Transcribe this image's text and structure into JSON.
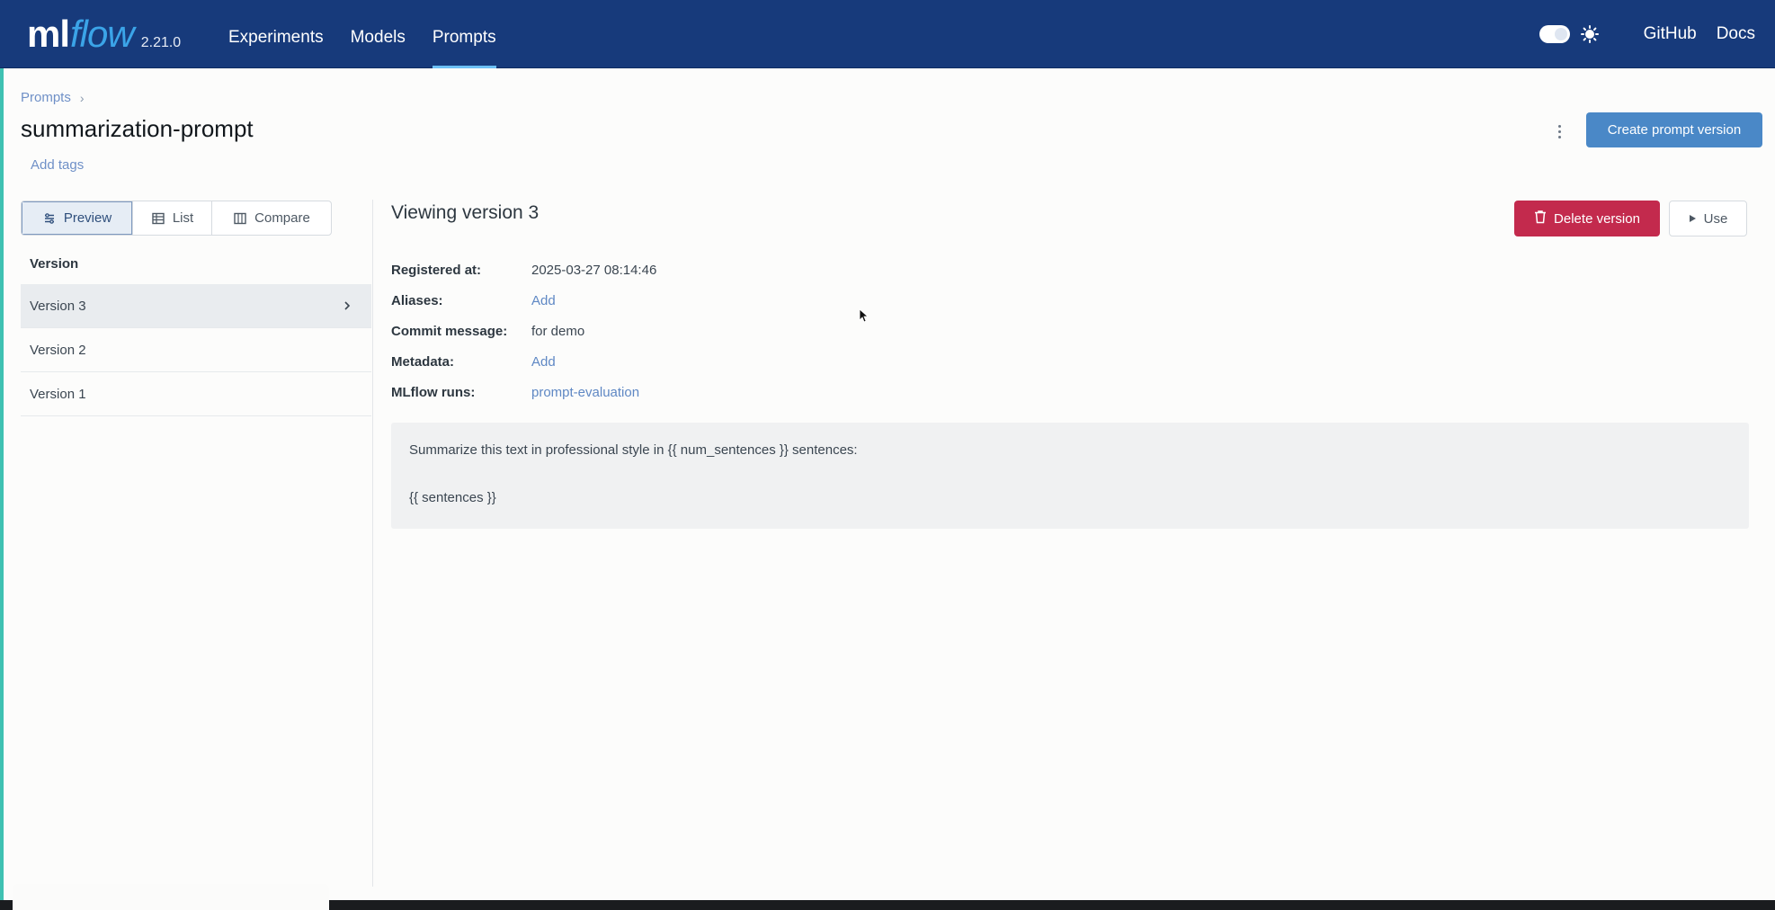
{
  "nav": {
    "logo_ml": "ml",
    "logo_flow": "flow",
    "version": "2.21.0",
    "links": [
      "Experiments",
      "Models",
      "Prompts"
    ],
    "active_link": "Prompts",
    "github": "GitHub",
    "docs": "Docs",
    "icons": [
      "theme-toggle-icon",
      "sun-icon"
    ]
  },
  "header": {
    "breadcrumb": "Prompts",
    "breadcrumb_separator": "›",
    "title": "summarization-prompt",
    "add_tags": "Add tags",
    "create_button": "Create prompt version",
    "more_icon": "kebab-menu-icon"
  },
  "view_modes": {
    "preview": "Preview",
    "list": "List",
    "compare": "Compare",
    "active": "Preview"
  },
  "versions": {
    "header": "Version",
    "items": [
      "Version 3",
      "Version 2",
      "Version 1"
    ],
    "selected": "Version 3"
  },
  "detail": {
    "title": "Viewing version 3",
    "delete_button": "Delete version",
    "use_button": "Use",
    "fields": {
      "registered_label": "Registered at:",
      "registered_value": "2025-03-27 08:14:46",
      "aliases_label": "Aliases:",
      "aliases_value": "Add",
      "commit_label": "Commit message:",
      "commit_value": "for demo",
      "metadata_label": "Metadata:",
      "metadata_value": "Add",
      "runs_label": "MLflow runs:",
      "runs_value": "prompt-evaluation"
    },
    "template_line_1": "Summarize this text in professional style in {{ num_sentences }} sentences:",
    "template_line_2": "{{ sentences }}"
  },
  "colors": {
    "nav_bg": "#173a7b",
    "primary_button": "#4a88c7",
    "danger_button": "#c32a4d",
    "link": "#5f88c4",
    "accent_strip": "#3fc1b2"
  }
}
